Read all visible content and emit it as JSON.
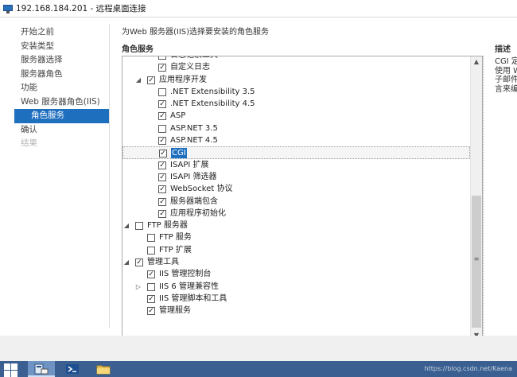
{
  "window": {
    "title": "192.168.184.201 - 远程桌面连接",
    "icon": "remote-desktop-icon"
  },
  "nav": {
    "items": [
      {
        "label": "开始之前",
        "state": "normal"
      },
      {
        "label": "安装类型",
        "state": "normal"
      },
      {
        "label": "服务器选择",
        "state": "normal"
      },
      {
        "label": "服务器角色",
        "state": "normal"
      },
      {
        "label": "功能",
        "state": "normal"
      },
      {
        "label": "Web 服务器角色(IIS)",
        "state": "normal"
      },
      {
        "label": "角色服务",
        "state": "active"
      },
      {
        "label": "确认",
        "state": "normal"
      },
      {
        "label": "结果",
        "state": "disabled"
      }
    ]
  },
  "main": {
    "header": "为Web 服务器(IIS)选择要安装的角色服务",
    "section_title": "角色服务"
  },
  "tree": {
    "rows": [
      {
        "label": "日志记录工具",
        "checked": true,
        "expander": "none",
        "level": 2
      },
      {
        "label": "自定义日志",
        "checked": true,
        "expander": "none",
        "level": 2
      },
      {
        "label": "应用程序开发",
        "checked": true,
        "expander": "expanded",
        "level": 1
      },
      {
        "label": ".NET Extensibility 3.5",
        "checked": false,
        "expander": "none",
        "level": 2
      },
      {
        "label": ".NET Extensibility 4.5",
        "checked": true,
        "expander": "none",
        "level": 2
      },
      {
        "label": "ASP",
        "checked": true,
        "expander": "none",
        "level": 2
      },
      {
        "label": "ASP.NET 3.5",
        "checked": false,
        "expander": "none",
        "level": 2
      },
      {
        "label": "ASP.NET 4.5",
        "checked": true,
        "expander": "none",
        "level": 2
      },
      {
        "label": "CGI",
        "checked": true,
        "expander": "none",
        "level": 2,
        "selected": true
      },
      {
        "label": "ISAPI 扩展",
        "checked": true,
        "expander": "none",
        "level": 2
      },
      {
        "label": "ISAPI 筛选器",
        "checked": true,
        "expander": "none",
        "level": 2
      },
      {
        "label": "WebSocket 协议",
        "checked": true,
        "expander": "none",
        "level": 2
      },
      {
        "label": "服务器端包含",
        "checked": true,
        "expander": "none",
        "level": 2
      },
      {
        "label": "应用程序初始化",
        "checked": true,
        "expander": "none",
        "level": 2
      },
      {
        "label": "FTP 服务器",
        "checked": false,
        "expander": "expanded",
        "level": 0
      },
      {
        "label": "FTP 服务",
        "checked": false,
        "expander": "none",
        "level": 1
      },
      {
        "label": "FTP 扩展",
        "checked": false,
        "expander": "none",
        "level": 1
      },
      {
        "label": "管理工具",
        "checked": true,
        "expander": "expanded",
        "level": 0
      },
      {
        "label": "IIS 管理控制台",
        "checked": true,
        "expander": "none",
        "level": 1
      },
      {
        "label": "IIS 6 管理兼容性",
        "checked": false,
        "expander": "collapsed",
        "level": 1
      },
      {
        "label": "IIS 管理脚本和工具",
        "checked": true,
        "expander": "none",
        "level": 1
      },
      {
        "label": "管理服务",
        "checked": true,
        "expander": "none",
        "level": 1
      }
    ],
    "check_glyph": "✓",
    "expanded_glyph": "◢",
    "collapsed_glyph": "▷"
  },
  "scrollbar": {
    "up_glyph": "▲",
    "down_glyph": "▼",
    "grip_glyph": "≡"
  },
  "description": {
    "title": "描述",
    "lines": [
      "CGI 定",
      "使用 W",
      "子邮件",
      "言来编"
    ]
  },
  "taskbar": {
    "apps": [
      "server-manager-icon",
      "powershell-icon",
      "file-explorer-icon"
    ],
    "watermark": "https://blog.csdn.net/Kaena"
  },
  "colors": {
    "accent": "#1f6fbf",
    "taskbar": "#3a5f90"
  }
}
